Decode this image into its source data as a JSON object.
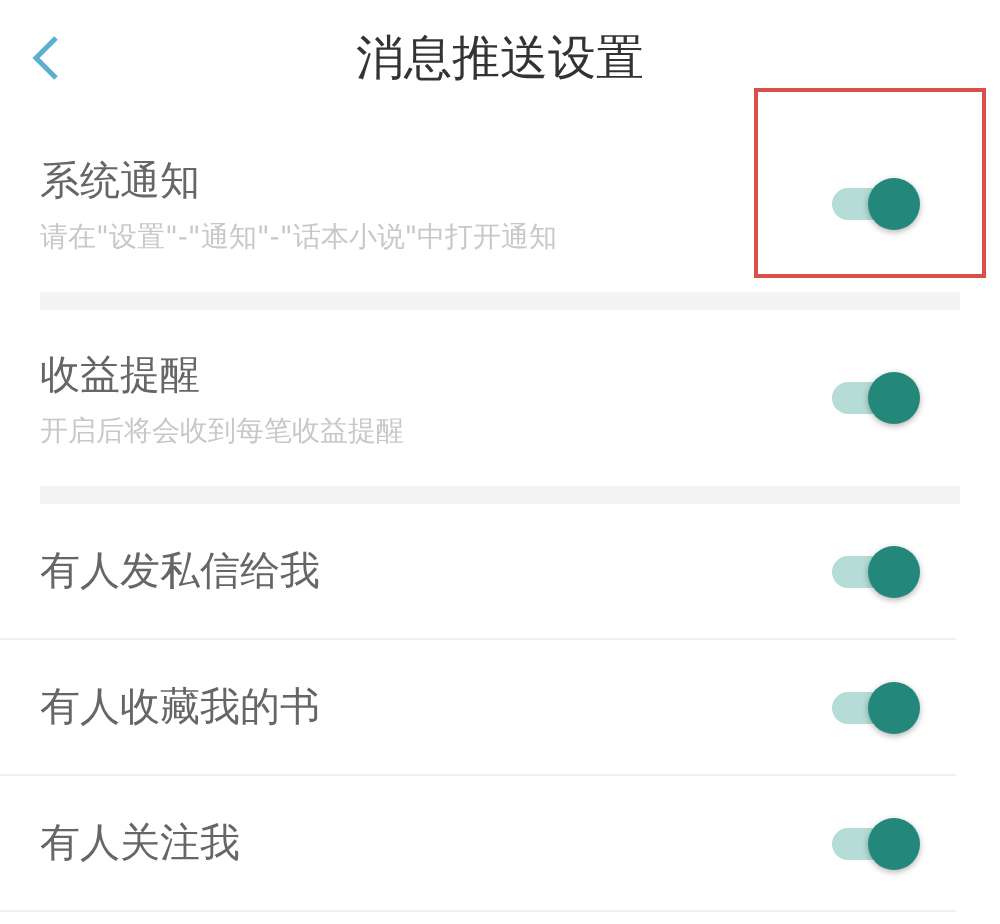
{
  "header": {
    "title": "消息推送设置"
  },
  "groups": [
    {
      "items": [
        {
          "title": "系统通知",
          "subtitle": "请在\"设置\"-\"通知\"-\"话本小说\"中打开通知",
          "on": true,
          "highlighted": true
        }
      ]
    },
    {
      "items": [
        {
          "title": "收益提醒",
          "subtitle": "开启后将会收到每笔收益提醒",
          "on": true,
          "highlighted": false
        }
      ]
    },
    {
      "items": [
        {
          "title": "有人发私信给我",
          "on": true,
          "highlighted": false
        },
        {
          "title": "有人收藏我的书",
          "on": true,
          "highlighted": false
        },
        {
          "title": "有人关注我",
          "on": true,
          "highlighted": false
        }
      ]
    }
  ]
}
